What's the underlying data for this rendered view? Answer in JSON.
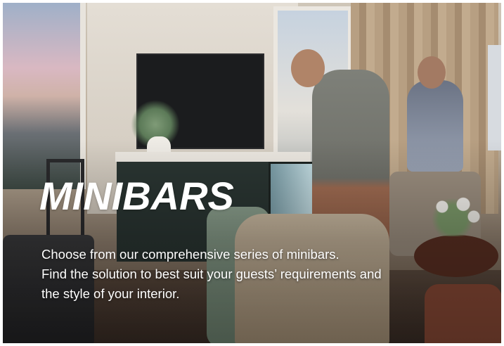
{
  "hero": {
    "title": "MINIBARS",
    "description_lines": [
      "Choose from our comprehensive series of minibars.",
      "Find the solution to best suit your guests’ requirements and",
      "the style of your interior."
    ]
  },
  "colors": {
    "text": "#ffffff",
    "frame": "#ffffff"
  }
}
